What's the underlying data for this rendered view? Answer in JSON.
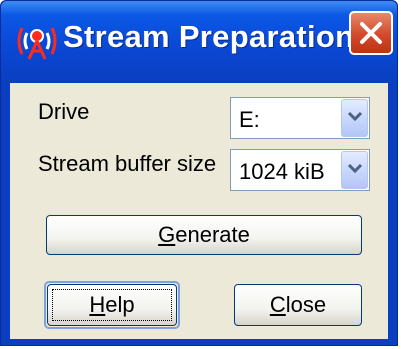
{
  "window": {
    "title": "Stream Preparation ...",
    "icon": "broadcast-antenna-icon",
    "close_icon": "close-icon"
  },
  "form": {
    "drive_label": "Drive",
    "drive_value": "E:",
    "buffer_label": "Stream buffer size",
    "buffer_value": "1024 kiB"
  },
  "buttons": {
    "generate": {
      "mnemonic": "G",
      "rest": "enerate"
    },
    "help": {
      "mnemonic": "H",
      "rest": "elp"
    },
    "close": {
      "mnemonic": "C",
      "rest": "lose"
    }
  },
  "colors": {
    "titlebar": "#0a48d6",
    "client": "#ece9d8",
    "close_button": "#d2492b"
  }
}
